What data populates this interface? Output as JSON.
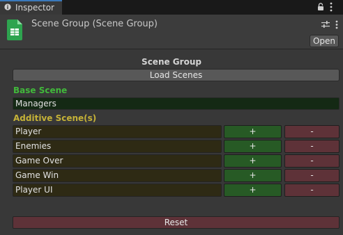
{
  "tab": {
    "label": "Inspector"
  },
  "header": {
    "title": "Scene Group (Scene Group)",
    "open_label": "Open"
  },
  "section": {
    "title": "Scene Group",
    "load_label": "Load Scenes"
  },
  "base": {
    "label": "Base Scene",
    "value": "Managers"
  },
  "additive": {
    "label": "Additive Scene(s)",
    "rows": [
      {
        "name": "Player",
        "plus": "+",
        "minus": "-"
      },
      {
        "name": "Enemies",
        "plus": "+",
        "minus": "-"
      },
      {
        "name": "Game Over",
        "plus": "+",
        "minus": "-"
      },
      {
        "name": "Game Win",
        "plus": "+",
        "minus": "-"
      },
      {
        "name": "Player UI",
        "plus": "+",
        "minus": "-"
      }
    ]
  },
  "reset_label": "Reset",
  "colors": {
    "base_label": "#41b93b",
    "additive_label": "#c5b237",
    "add_button": "#275a25",
    "remove_button": "#5e3238",
    "tab_accent": "#3a79bb"
  }
}
